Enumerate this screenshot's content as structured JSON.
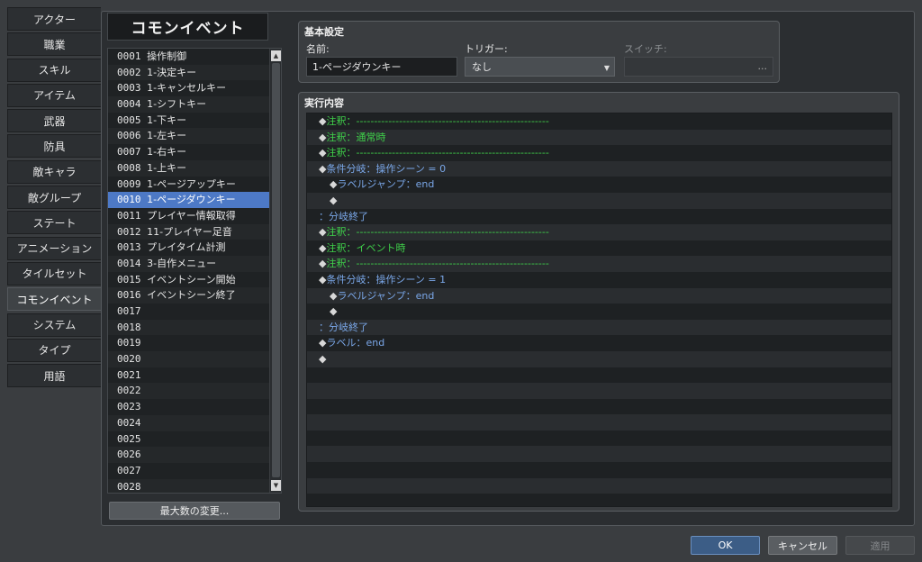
{
  "nav": {
    "items": [
      {
        "label": "アクター"
      },
      {
        "label": "職業"
      },
      {
        "label": "スキル"
      },
      {
        "label": "アイテム"
      },
      {
        "label": "武器"
      },
      {
        "label": "防具"
      },
      {
        "label": "敵キャラ"
      },
      {
        "label": "敵グループ"
      },
      {
        "label": "ステート"
      },
      {
        "label": "アニメーション"
      },
      {
        "label": "タイルセット"
      },
      {
        "label": "コモンイベント"
      },
      {
        "label": "システム"
      },
      {
        "label": "タイプ"
      },
      {
        "label": "用語"
      }
    ],
    "active_index": 11
  },
  "list": {
    "title": "コモンイベント",
    "selected_index": 9,
    "rows": [
      {
        "id": "0001",
        "name": "操作制御"
      },
      {
        "id": "0002",
        "name": "1-決定キー"
      },
      {
        "id": "0003",
        "name": "1-キャンセルキー"
      },
      {
        "id": "0004",
        "name": "1-シフトキー"
      },
      {
        "id": "0005",
        "name": "1-下キー"
      },
      {
        "id": "0006",
        "name": "1-左キー"
      },
      {
        "id": "0007",
        "name": "1-右キー"
      },
      {
        "id": "0008",
        "name": "1-上キー"
      },
      {
        "id": "0009",
        "name": "1-ページアップキー"
      },
      {
        "id": "0010",
        "name": "1-ページダウンキー"
      },
      {
        "id": "0011",
        "name": "プレイヤー情報取得"
      },
      {
        "id": "0012",
        "name": "11-プレイヤー足音"
      },
      {
        "id": "0013",
        "name": "プレイタイム計測"
      },
      {
        "id": "0014",
        "name": "3-自作メニュー"
      },
      {
        "id": "0015",
        "name": "イベントシーン開始"
      },
      {
        "id": "0016",
        "name": "イベントシーン終了"
      },
      {
        "id": "0017",
        "name": ""
      },
      {
        "id": "0018",
        "name": ""
      },
      {
        "id": "0019",
        "name": ""
      },
      {
        "id": "0020",
        "name": ""
      },
      {
        "id": "0021",
        "name": ""
      },
      {
        "id": "0022",
        "name": ""
      },
      {
        "id": "0023",
        "name": ""
      },
      {
        "id": "0024",
        "name": ""
      },
      {
        "id": "0025",
        "name": ""
      },
      {
        "id": "0026",
        "name": ""
      },
      {
        "id": "0027",
        "name": ""
      },
      {
        "id": "0028",
        "name": ""
      }
    ],
    "max_button_label": "最大数の変更..."
  },
  "basic": {
    "title": "基本設定",
    "name_label": "名前:",
    "name_value": "1-ページダウンキー",
    "trigger_label": "トリガー:",
    "trigger_value": "なし",
    "switch_label": "スイッチ:",
    "switch_dots": "..."
  },
  "exec": {
    "title": "実行内容",
    "commands": [
      {
        "indent": 0,
        "marker": "◆",
        "text": "注釈：------------------------------------------------------",
        "color": "green"
      },
      {
        "indent": 0,
        "marker": "◆",
        "text": "注釈：通常時",
        "color": "green"
      },
      {
        "indent": 0,
        "marker": "◆",
        "text": "注釈：------------------------------------------------------",
        "color": "green"
      },
      {
        "indent": 0,
        "marker": "◆",
        "text": "条件分岐：操作シーン = 0",
        "color": "blue"
      },
      {
        "indent": 1,
        "marker": "◆",
        "text": "ラベルジャンプ：end",
        "color": "blue"
      },
      {
        "indent": 1,
        "marker": "◆",
        "text": "",
        "color": "gray"
      },
      {
        "indent": 0,
        "marker": "",
        "text": "：分岐終了",
        "color": "blue"
      },
      {
        "indent": 0,
        "marker": "◆",
        "text": "注釈：------------------------------------------------------",
        "color": "green"
      },
      {
        "indent": 0,
        "marker": "◆",
        "text": "注釈：イベント時",
        "color": "green"
      },
      {
        "indent": 0,
        "marker": "◆",
        "text": "注釈：------------------------------------------------------",
        "color": "green"
      },
      {
        "indent": 0,
        "marker": "◆",
        "text": "条件分岐：操作シーン = 1",
        "color": "blue"
      },
      {
        "indent": 1,
        "marker": "◆",
        "text": "ラベルジャンプ：end",
        "color": "blue"
      },
      {
        "indent": 1,
        "marker": "◆",
        "text": "",
        "color": "gray"
      },
      {
        "indent": 0,
        "marker": "",
        "text": "：分岐終了",
        "color": "blue"
      },
      {
        "indent": 0,
        "marker": "◆",
        "text": "ラベル：end",
        "color": "blue"
      },
      {
        "indent": 0,
        "marker": "◆",
        "text": "",
        "color": "gray"
      },
      {
        "indent": 0,
        "marker": "",
        "text": "",
        "color": "gray"
      },
      {
        "indent": 0,
        "marker": "",
        "text": "",
        "color": "gray"
      },
      {
        "indent": 0,
        "marker": "",
        "text": "",
        "color": "gray"
      },
      {
        "indent": 0,
        "marker": "",
        "text": "",
        "color": "gray"
      },
      {
        "indent": 0,
        "marker": "",
        "text": "",
        "color": "gray"
      },
      {
        "indent": 0,
        "marker": "",
        "text": "",
        "color": "gray"
      },
      {
        "indent": 0,
        "marker": "",
        "text": "",
        "color": "gray"
      },
      {
        "indent": 0,
        "marker": "",
        "text": "",
        "color": "gray"
      },
      {
        "indent": 0,
        "marker": "",
        "text": "",
        "color": "gray"
      }
    ]
  },
  "footer": {
    "ok_label": "OK",
    "cancel_label": "キャンセル",
    "apply_label": "適用"
  },
  "colors": {
    "green": "#3fd04a",
    "blue": "#7aa7e8",
    "selection": "#4d79c6"
  }
}
